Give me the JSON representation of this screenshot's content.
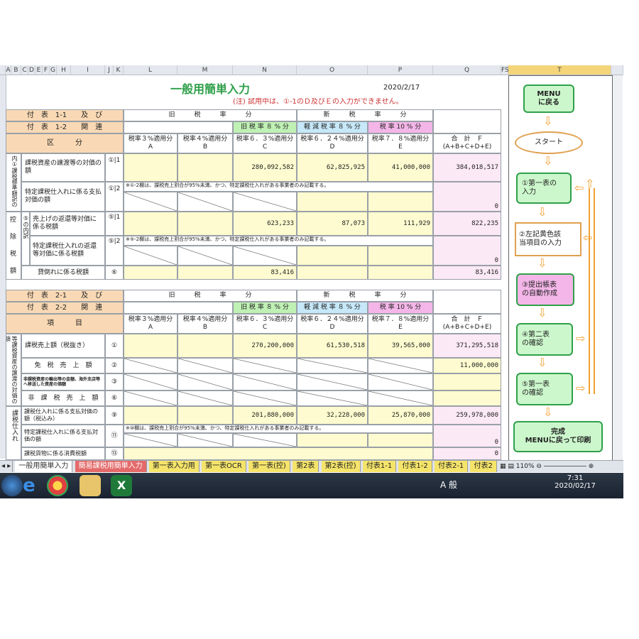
{
  "colors": {
    "yellow": "#fdfbcf",
    "pink": "#fbe9f5",
    "green": "#bff0b4",
    "blue": "#c6e8f8",
    "magenta": "#f4b6e8",
    "title": "#2fa04a",
    "note": "#cc3333"
  },
  "columns": [
    "A",
    "B",
    "C",
    "D",
    "E",
    "F",
    "G",
    "H",
    "I",
    "J",
    "K",
    "L",
    "M",
    "N",
    "O",
    "P",
    "Q",
    "FS",
    "T"
  ],
  "sheet": {
    "title": "一般用簡単入力",
    "date": "2020/2/17",
    "note": "(注) 試用中は、①-1のＤ及びＥの入力ができません。",
    "section1": {
      "head_line1": "付　表　1-1　　及　び",
      "head_line2": "付　表　1-2　　関　連",
      "old_rate": "旧　　　税　　　率　　　分",
      "new_rate": "新　　　税　　　率　　　分",
      "old8": "旧 税 率 ８ % 分",
      "red8": "軽 減 税 率 ８ % 分",
      "rate10": "税 率 10 % 分",
      "kubun": "区　　　分",
      "h_A": "税率３%適用分",
      "h_A2": "A",
      "h_B": "税率４%適用分",
      "h_B2": "B",
      "h_C": "税率６．３%適用分",
      "h_C2": "C",
      "h_D": "税率６．２４%適用分",
      "h_D2": "D",
      "h_E": "税率７．８%適用分",
      "h_E2": "E",
      "h_F": "合　計　Ｆ",
      "h_F2": "(A+B+C+D+E)",
      "side1": "内①課税標準額訳の",
      "r1_label": "課税資産の譲渡等の対価の額",
      "r1_no": "①|1",
      "r1_C": "280,092,582",
      "r1_D": "62,825,925",
      "r1_E": "41,000,000",
      "r1_F": "384,018,517",
      "r2_label": "特定課税仕入れに係る支払対価の額",
      "r2_no": "①|2",
      "r2_note": "※①-2欄は、課税売上割合が95%未満、かつ、特定課税仕入れがある事業者のみ記載する。",
      "r2_F": "0",
      "side2a": "控",
      "side2b": "除",
      "side2c": "税",
      "side2d": "額",
      "side2_sub": "⑤の内訳",
      "r3_label": "売上げの返還等対価に係る税額",
      "r3_no": "⑤|1",
      "r3_C": "623,233",
      "r3_D": "87,073",
      "r3_E": "111,929",
      "r3_F": "822,235",
      "r4_label": "特定課税仕入れの返還等対価に係る税額",
      "r4_no": "⑤|2",
      "r4_note": "※⑤-2欄は、課税売上割合が95%未満、かつ、特定課税仕入れがある事業者のみ記載する。",
      "r4_F": "0",
      "r5_label": "貸倒れに係る税額",
      "r5_no": "⑥",
      "r5_C": "83,416",
      "r5_F": "83,416"
    },
    "section2": {
      "head_line1": "付　表　2-1　　及　び",
      "head_line2": "付　表　2-2　　関　連",
      "old_rate": "旧　　　税　　　率　　　分",
      "new_rate": "新　　　税　　　率　　　分",
      "old8": "旧 税 率 ８ % 分",
      "red8": "軽 減 税 率 ８ % 分",
      "rate10": "税 率 10 % 分",
      "koumoku": "項　　　目",
      "h_A": "税率３%適用分",
      "h_A2": "A",
      "h_B": "税率４%適用分",
      "h_B2": "B",
      "h_C": "税率６．３%適用分",
      "h_C2": "C",
      "h_D": "税率６．２４%適用分",
      "h_D2": "D",
      "h_E": "税率７．８%適用分",
      "h_E2": "E",
      "h_F": "合　計　Ｆ",
      "h_F2": "(A+B+C+D+E)",
      "side1": "等課税資産の譲渡の対価の額",
      "r1_label": "課税売上額（税抜き）",
      "r1_no": "①",
      "r1_C": "270,200,000",
      "r1_D": "61,530,518",
      "r1_E": "39,565,000",
      "r1_F": "371,295,518",
      "r2_label": "免　税　売　上　額",
      "r2_no": "②",
      "r2_F": "11,000,000",
      "r3_label": "非課税資産の輸出等の金額、海外支店等へ移送した資産の価額",
      "r3_no": "③",
      "r4_label": "非　課　税　売　上　額",
      "r4_no": "⑥",
      "side2": "課税仕入れ",
      "r5_label": "課税仕入れに係る支払対価の額（税込み）",
      "r5_no": "⑨",
      "r5_C": "201,880,000",
      "r5_D": "32,228,000",
      "r5_E": "25,870,000",
      "r5_F": "259,978,000",
      "r6_label": "特定課税仕入れに係る支払対価の額",
      "r6_no": "⑪",
      "r6_note": "※⑩欄は、課税売上割合が95%未満、かつ、特定課税仕入れがある事業者のみ記載する。",
      "r6_F": "0",
      "r7_label": "課税貨物に係る消費税額",
      "r7_no": "⑬",
      "r7_F": "0"
    }
  },
  "flow": {
    "menu": "MENU\nに戻る",
    "start": "スタート",
    "step1": "①第一表の\n入力",
    "step2": "②左記黄色該\n当項目の入力",
    "step3": "③提出帳表\nの自動作成",
    "step4": "④第二表\nの確認",
    "step5": "⑤第一表\nの確認",
    "done": "完成\nMENUに戻って印刷"
  },
  "tabs": [
    "一般用簡単入力",
    "簡易課税用簡単入力",
    "第一表入力用",
    "第一表OCR",
    "第一表(控)",
    "第2表",
    "第2表(控)",
    "付表1-1",
    "付表1-2",
    "付表2-1",
    "付表2"
  ],
  "status": {
    "zoom": "110%"
  },
  "taskbar": {
    "ime": "A 般",
    "time": "7:31",
    "date": "2020/02/17"
  }
}
